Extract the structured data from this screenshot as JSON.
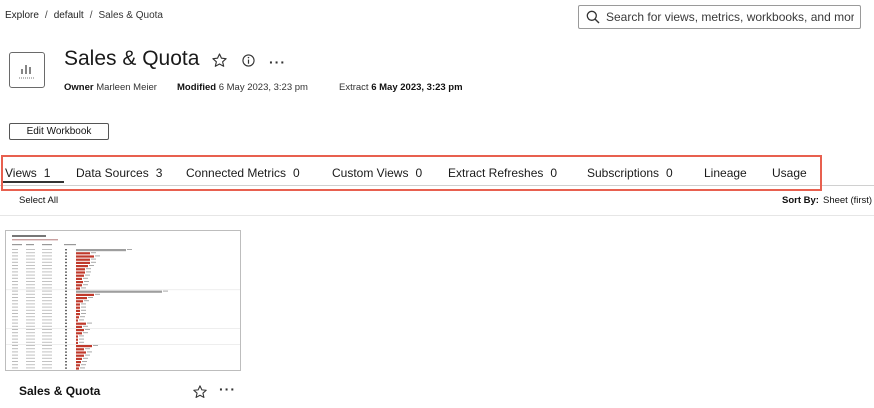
{
  "breadcrumb": {
    "items": [
      "Explore",
      "default",
      "Sales & Quota"
    ]
  },
  "search": {
    "placeholder": "Search for views, metrics, workbooks, and more"
  },
  "workbook": {
    "title": "Sales & Quota",
    "owner_label": "Owner",
    "owner_value": "Marleen Meier",
    "modified_label": "Modified",
    "modified_value": "6 May 2023, 3:23 pm",
    "extract_label": "Extract",
    "extract_value": "6 May 2023, 3:23 pm",
    "edit_button": "Edit Workbook"
  },
  "tabs": [
    {
      "label": "Views",
      "count": "1",
      "active": true
    },
    {
      "label": "Data Sources",
      "count": "3"
    },
    {
      "label": "Connected Metrics",
      "count": "0"
    },
    {
      "label": "Custom Views",
      "count": "0"
    },
    {
      "label": "Extract Refreshes",
      "count": "0"
    },
    {
      "label": "Subscriptions",
      "count": "0"
    },
    {
      "label": "Lineage",
      "count": ""
    },
    {
      "label": "Usage",
      "count": ""
    }
  ],
  "toolbar": {
    "select_all": "Select All",
    "sort_label": "Sort By:",
    "sort_value": "Sheet (first)"
  },
  "views": [
    {
      "name": "Sales & Quota"
    }
  ],
  "colors": {
    "highlight_border": "#e8604f",
    "thumbnail_bar": "#c0392b",
    "thumbnail_bar_gray": "#9e9e9e"
  }
}
